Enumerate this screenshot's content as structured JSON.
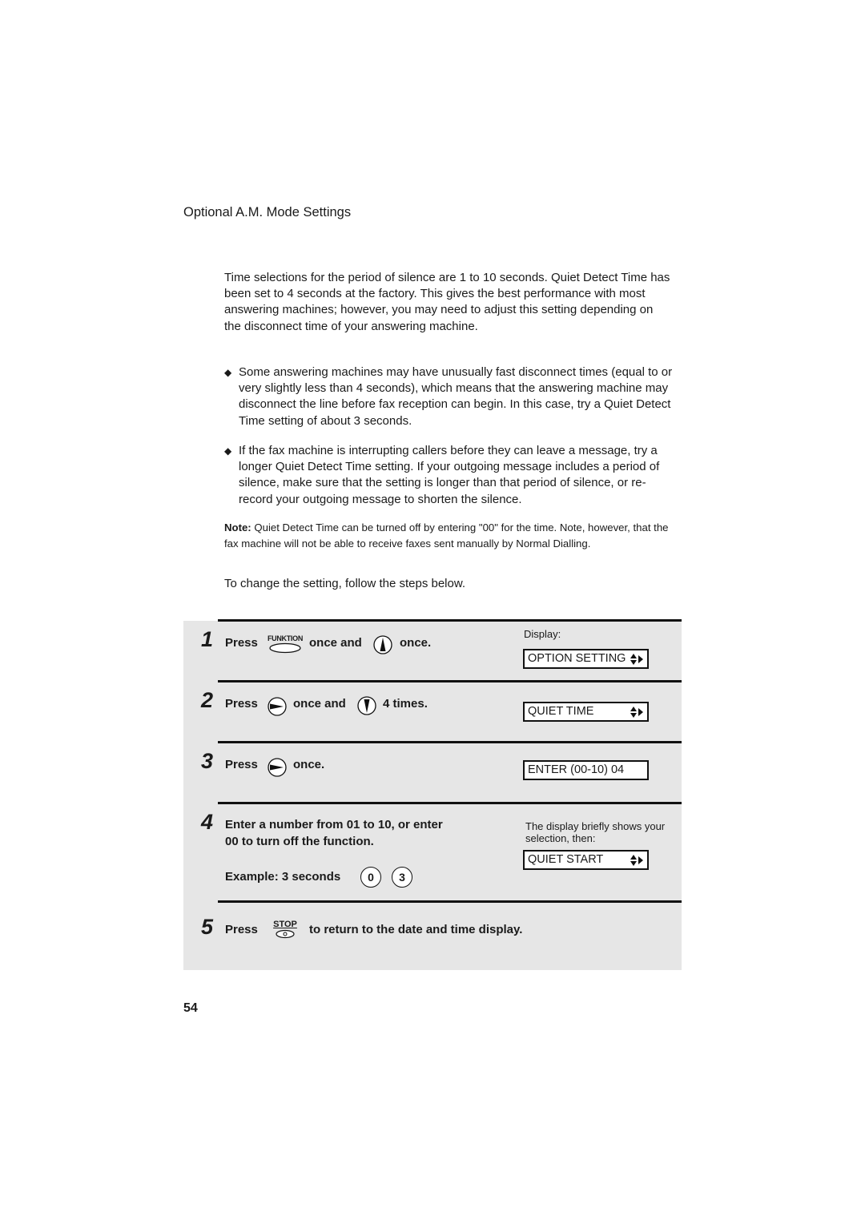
{
  "header": {
    "title": "Optional A.M. Mode Settings"
  },
  "intro": "Time selections for the period of silence are 1 to 10 seconds. Quiet Detect Time has been set to 4 seconds at the factory. This gives the best performance with most answering machines; however, you may need to adjust this setting depending on the disconnect time of your answering machine.",
  "bullets": [
    "Some answering machines may have unusually fast disconnect times (equal to or very slightly less than 4 seconds), which means that the answering machine may disconnect the line before fax reception can begin. In this case, try a Quiet Detect Time setting of about 3 seconds.",
    "If the fax machine is interrupting callers before they can leave a message, try a longer Quiet Detect Time setting. If your outgoing message includes a period of silence, make sure that the setting is longer than that period of silence, or re-record your outgoing message to shorten the silence."
  ],
  "note": {
    "label": "Note:",
    "text": " Quiet Detect Time can be turned off by entering \"00\" for the time. Note, however, that the fax machine will not be able to receive faxes sent manually by Normal Dialling."
  },
  "follow": "To change the setting, follow the steps below.",
  "steps": [
    {
      "num": "1",
      "press": "Press",
      "key1": "FUNKTION",
      "mid": "once and",
      "end": "once.",
      "display_label": "Display:",
      "display": "OPTION SETTING"
    },
    {
      "num": "2",
      "press": "Press",
      "mid": "once and",
      "end": "4 times.",
      "display": "QUIET TIME"
    },
    {
      "num": "3",
      "press": "Press",
      "end": "once.",
      "display": "ENTER (00-10) 04"
    },
    {
      "num": "4",
      "line1": "Enter a number from 01 to 10, or enter",
      "line2": "00 to turn off the function.",
      "example": "Example: 3 seconds",
      "keys": [
        "0",
        "3"
      ],
      "display_note": "The display briefly shows your selection, then:",
      "display": "QUIET START"
    },
    {
      "num": "5",
      "press": "Press",
      "key": "STOP",
      "end": "to return to the date and time display."
    }
  ],
  "page_number": "54"
}
